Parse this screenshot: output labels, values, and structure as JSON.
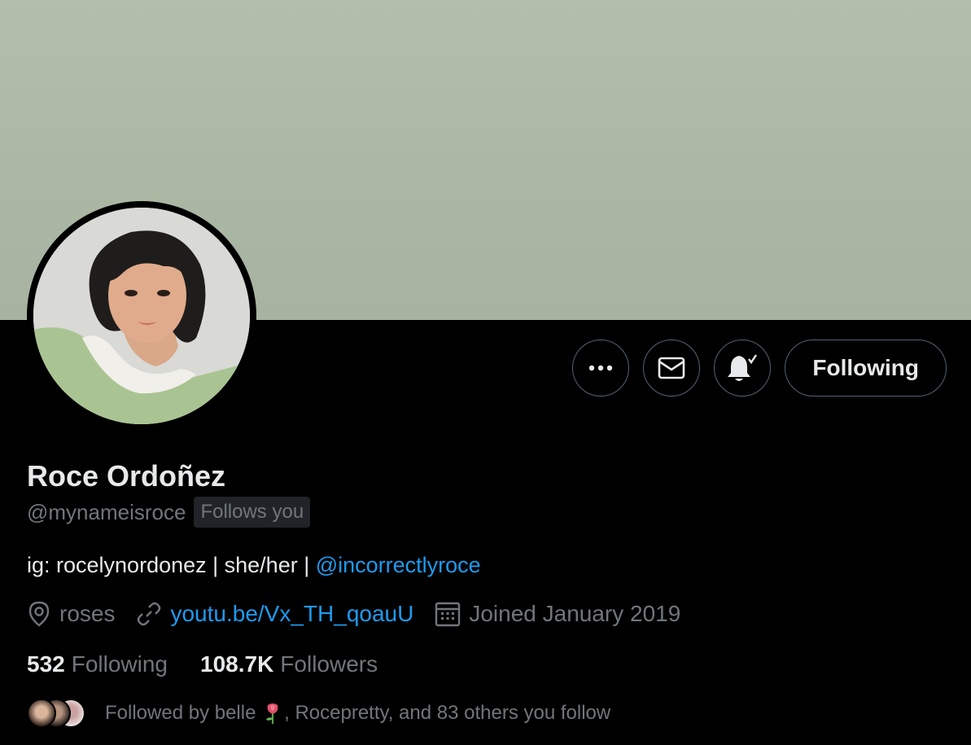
{
  "profile": {
    "display_name": "Roce Ordoñez",
    "handle": "@mynameisroce",
    "follows_you_badge": "Follows you",
    "bio_text": "ig: rocelynordonez | she/her | ",
    "bio_mention": "@incorrectlyroce",
    "location": "roses",
    "website": "youtu.be/Vx_TH_qoauU",
    "joined": "Joined January 2019"
  },
  "actions": {
    "more_icon": "more-horizontal-icon",
    "message_icon": "envelope-icon",
    "notify_icon": "bell-check-icon",
    "following_label": "Following"
  },
  "stats": {
    "following_count": "532",
    "following_label": "Following",
    "followers_count": "108.7K",
    "followers_label": "Followers"
  },
  "followed_by": {
    "prefix": "Followed by belle",
    "suffix": ", Rocepretty, and 83 others you follow"
  },
  "colors": {
    "background": "#000000",
    "accent": "#1d9bf0",
    "secondary_text": "#71767b",
    "primary_text": "#e7e9ea",
    "banner": "#aab7a3"
  }
}
